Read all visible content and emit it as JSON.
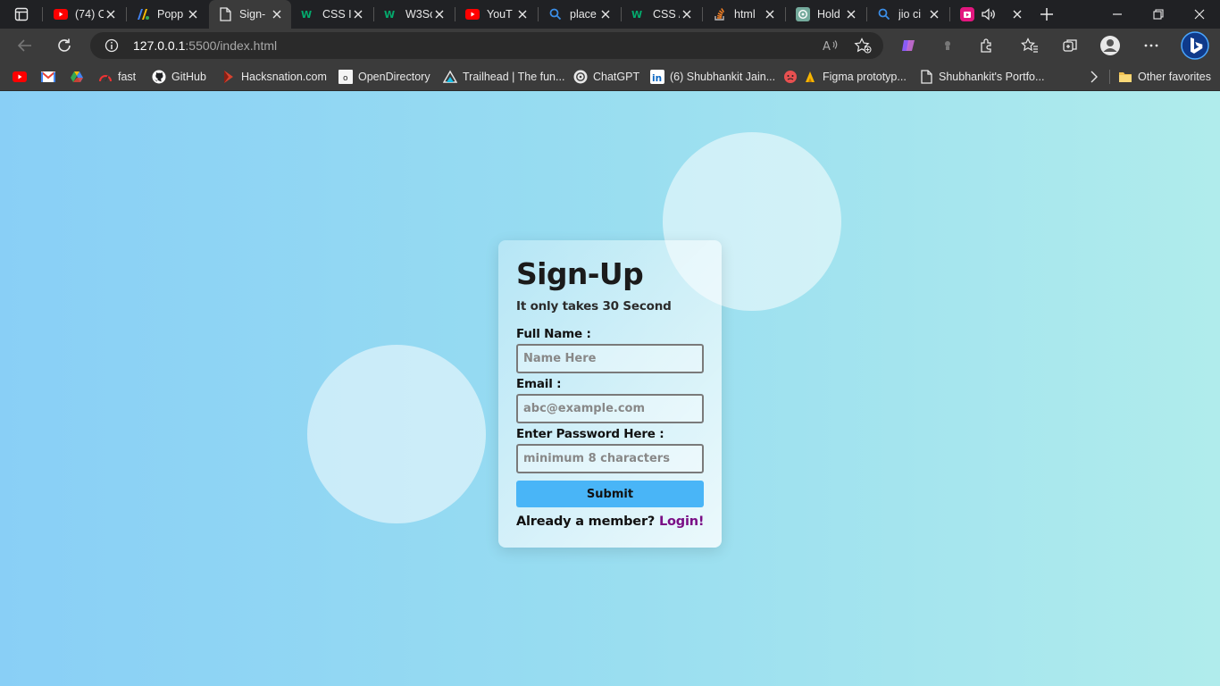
{
  "browser": {
    "tabs": [
      {
        "title": "(74) C",
        "icon": "youtube-icon"
      },
      {
        "title": "Popp",
        "icon": "poppins-font-icon"
      },
      {
        "title": "Sign-",
        "icon": "page-icon",
        "active": true
      },
      {
        "title": "CSS I",
        "icon": "w3-icon"
      },
      {
        "title": "W3Sc",
        "icon": "w3-icon"
      },
      {
        "title": "YouT",
        "icon": "youtube-icon"
      },
      {
        "title": "place",
        "icon": "search-icon"
      },
      {
        "title": "CSS /",
        "icon": "w3-icon"
      },
      {
        "title": "html",
        "icon": "stackoverflow-icon"
      },
      {
        "title": "Hold",
        "icon": "chatgpt-icon"
      },
      {
        "title": "jio ci",
        "icon": "search-icon"
      },
      {
        "title": "",
        "icon": "media-icon"
      }
    ],
    "address_bar": {
      "host": "127.0.0.1",
      "path": ":5500/index.html"
    },
    "bookmarks": [
      {
        "label": "",
        "icon": "youtube-icon"
      },
      {
        "label": "",
        "icon": "gmail-icon"
      },
      {
        "label": "",
        "icon": "drive-icon"
      },
      {
        "label": "fast",
        "icon": "speedometer-icon"
      },
      {
        "label": "GitHub",
        "icon": "github-icon"
      },
      {
        "label": "Hacksnation.com",
        "icon": "hacksnation-icon"
      },
      {
        "label": "OpenDirectory",
        "icon": "opendirectory-icon"
      },
      {
        "label": "Trailhead | The fun...",
        "icon": "trailhead-icon"
      },
      {
        "label": "ChatGPT",
        "icon": "chatgpt-icon"
      },
      {
        "label": "(6) Shubhankit Jain...",
        "icon": "linkedin-icon"
      },
      {
        "label": "Figma prototyp...",
        "icon": "figma-icon"
      },
      {
        "label": "Shubhankit's Portfo...",
        "icon": "page-icon"
      },
      {
        "label": "Other favorites",
        "icon": "folder-icon"
      }
    ]
  },
  "signup": {
    "title": "Sign-Up",
    "subtitle": "It only takes 30 Second",
    "fullname_label": "Full Name :",
    "fullname_placeholder": "Name Here",
    "email_label": "Email :",
    "email_placeholder": "abc@example.com",
    "password_label": "Enter Password Here :",
    "password_placeholder": "minimum 8 characters",
    "submit_label": "Submit",
    "already_text": "Already a member?",
    "login_link": "Login!"
  },
  "colors": {
    "page_gradient_start": "#89cff6",
    "page_gradient_end": "#b0ecec",
    "submit_button": "#49b5f7",
    "login_link": "#7a0f86"
  }
}
